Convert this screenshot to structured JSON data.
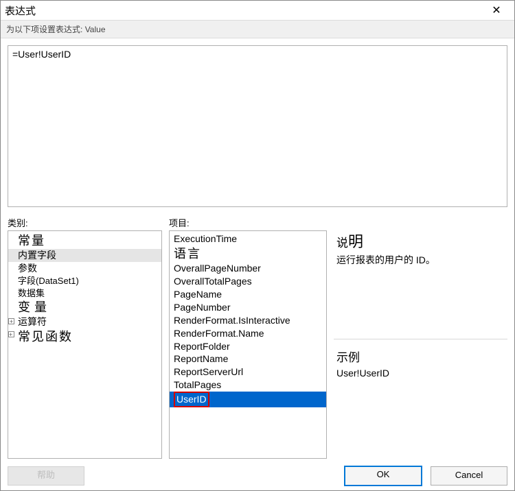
{
  "window": {
    "title": "表达式",
    "close_glyph": "✕"
  },
  "subheader": {
    "label_prefix": "为以下项设置表达式:",
    "target": "Value"
  },
  "editor": {
    "value": "=User!UserID"
  },
  "labels": {
    "category": "类别:",
    "items": "项目:",
    "description_heading_plain": "说",
    "description_heading_em": "明",
    "example_heading": "示例"
  },
  "categories": [
    {
      "text": "常量",
      "big": true,
      "plus": false
    },
    {
      "text": "内置字段",
      "big": false,
      "plus": false,
      "selected": true
    },
    {
      "text": "参数",
      "big": false,
      "plus": false
    },
    {
      "text": "字段(DataSet1)",
      "big": false,
      "plus": false,
      "small": true
    },
    {
      "text": "数据集",
      "big": false,
      "plus": false,
      "small": true
    },
    {
      "text": "变量",
      "big": true,
      "plus": false,
      "spaced": true
    },
    {
      "text": "运算符",
      "big": false,
      "plus": true
    },
    {
      "text": "常见函数",
      "big": true,
      "plus": true
    }
  ],
  "items": [
    {
      "text": "ExecutionTime"
    },
    {
      "text": "语言",
      "big": true
    },
    {
      "text": "OverallPageNumber"
    },
    {
      "text": "OverallTotalPages"
    },
    {
      "text": "PageName"
    },
    {
      "text": "PageNumber"
    },
    {
      "text": "RenderFormat.IsInteractive"
    },
    {
      "text": "RenderFormat.Name"
    },
    {
      "text": "ReportFolder"
    },
    {
      "text": "ReportName"
    },
    {
      "text": "ReportServerUrl"
    },
    {
      "text": "TotalPages"
    },
    {
      "text": "UserID",
      "selected": true
    }
  ],
  "description": {
    "body": "运行报表的用户的 ID。"
  },
  "example": {
    "body": "User!UserID"
  },
  "footer": {
    "help": "帮助",
    "ok": "OK",
    "cancel": "Cancel"
  }
}
